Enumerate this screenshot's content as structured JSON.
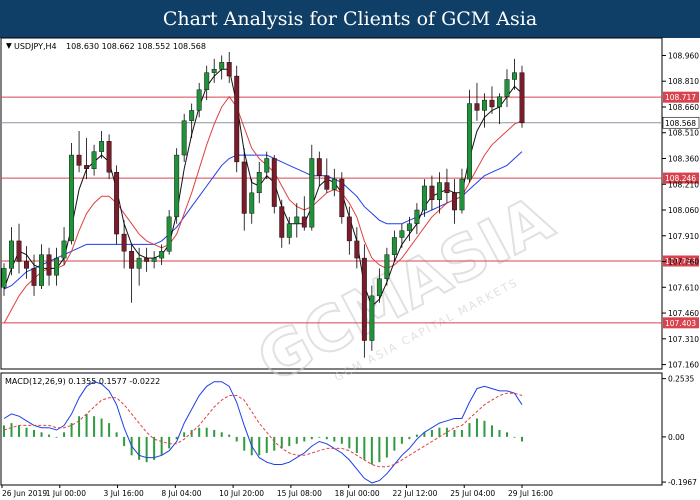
{
  "header": {
    "title": "Chart Analysis for Clients of GCM Asia"
  },
  "watermark": {
    "text": "GCMASIA",
    "subtext": "GCM ASIA CAPITAL MARKETS"
  },
  "chart_data": [
    {
      "type": "candlestick",
      "symbol_label": "USDJPY,H4",
      "ohlc_text": "108.630 108.662 108.552 108.568",
      "ylim": [
        107.14,
        109.05
      ],
      "y_ticks": [
        "108.960",
        "108.810",
        "108.660",
        "108.510",
        "108.360",
        "108.210",
        "108.060",
        "107.910",
        "107.760",
        "107.610",
        "107.460",
        "107.310",
        "107.160"
      ],
      "x_ticks": [
        "26 Jun 2019",
        "1 Jul 00:00",
        "3 Jul 16:00",
        "8 Jul 04:00",
        "10 Jul 20:00",
        "15 Jul 08:00",
        "18 Jul 00:00",
        "22 Jul 12:00",
        "25 Jul 04:00",
        "29 Jul 16:00"
      ],
      "levels": [
        {
          "label": "108.717",
          "value": 108.717,
          "color": "#d9434f"
        },
        {
          "label": "108.246",
          "value": 108.246,
          "color": "#d9434f"
        },
        {
          "label": "107.763",
          "value": 107.763,
          "color": "#d9434f"
        },
        {
          "label": "107.403",
          "value": 107.403,
          "color": "#d9434f"
        }
      ],
      "current_price": {
        "label": "108.568",
        "value": 108.568,
        "color": "#8a96a4"
      },
      "colors": {
        "bull": "#22913b",
        "bear": "#7a1c2a",
        "ma_fast": "#111111",
        "ma_mid": "#e04040",
        "ma_slow": "#1f3fe8"
      },
      "candles": [
        [
          107.61,
          107.75,
          107.56,
          107.72
        ],
        [
          107.72,
          107.96,
          107.68,
          107.88
        ],
        [
          107.88,
          107.98,
          107.69,
          107.76
        ],
        [
          107.76,
          107.85,
          107.66,
          107.72
        ],
        [
          107.72,
          107.8,
          107.56,
          107.62
        ],
        [
          107.62,
          107.86,
          107.6,
          107.8
        ],
        [
          107.8,
          107.84,
          107.62,
          107.68
        ],
        [
          107.68,
          107.84,
          107.62,
          107.78
        ],
        [
          107.78,
          107.96,
          107.74,
          107.88
        ],
        [
          107.88,
          108.45,
          107.86,
          108.38
        ],
        [
          108.38,
          108.52,
          108.28,
          108.32
        ],
        [
          108.32,
          108.48,
          108.24,
          108.3
        ],
        [
          108.3,
          108.44,
          108.26,
          108.4
        ],
        [
          108.4,
          108.52,
          108.36,
          108.46
        ],
        [
          108.46,
          108.5,
          108.24,
          108.28
        ],
        [
          108.28,
          108.32,
          107.86,
          107.92
        ],
        [
          107.92,
          108.0,
          107.72,
          107.82
        ],
        [
          107.82,
          107.86,
          107.52,
          107.72
        ],
        [
          107.72,
          107.84,
          107.62,
          107.78
        ],
        [
          107.78,
          107.84,
          107.7,
          107.76
        ],
        [
          107.76,
          107.82,
          107.72,
          107.78
        ],
        [
          107.78,
          107.86,
          107.74,
          107.82
        ],
        [
          107.82,
          108.06,
          107.8,
          108.02
        ],
        [
          108.02,
          108.42,
          107.98,
          108.38
        ],
        [
          108.38,
          108.62,
          108.34,
          108.58
        ],
        [
          108.58,
          108.68,
          108.48,
          108.64
        ],
        [
          108.64,
          108.8,
          108.6,
          108.76
        ],
        [
          108.76,
          108.9,
          108.7,
          108.86
        ],
        [
          108.86,
          108.94,
          108.8,
          108.88
        ],
        [
          108.88,
          108.96,
          108.82,
          108.92
        ],
        [
          108.92,
          108.98,
          108.8,
          108.84
        ],
        [
          108.84,
          108.9,
          108.28,
          108.34
        ],
        [
          108.34,
          108.42,
          107.94,
          108.04
        ],
        [
          108.04,
          108.24,
          107.98,
          108.16
        ],
        [
          108.16,
          108.34,
          108.1,
          108.28
        ],
        [
          108.28,
          108.4,
          108.24,
          108.36
        ],
        [
          108.36,
          108.38,
          108.04,
          108.08
        ],
        [
          108.08,
          108.12,
          107.84,
          107.9
        ],
        [
          107.9,
          108.02,
          107.86,
          107.98
        ],
        [
          107.98,
          108.1,
          107.9,
          108.02
        ],
        [
          108.02,
          108.14,
          107.94,
          107.96
        ],
        [
          107.96,
          108.44,
          107.94,
          108.36
        ],
        [
          108.36,
          108.4,
          108.2,
          108.26
        ],
        [
          108.26,
          108.36,
          108.16,
          108.18
        ],
        [
          108.18,
          108.3,
          108.14,
          108.24
        ],
        [
          108.24,
          108.28,
          107.98,
          108.02
        ],
        [
          108.02,
          108.08,
          107.8,
          107.88
        ],
        [
          107.88,
          107.96,
          107.72,
          107.78
        ],
        [
          107.78,
          107.86,
          107.2,
          107.3
        ],
        [
          107.3,
          107.62,
          107.24,
          107.56
        ],
        [
          107.56,
          107.72,
          107.52,
          107.66
        ],
        [
          107.66,
          107.84,
          107.62,
          107.8
        ],
        [
          107.8,
          107.94,
          107.76,
          107.9
        ],
        [
          107.9,
          107.98,
          107.84,
          107.94
        ],
        [
          107.94,
          108.02,
          107.88,
          107.98
        ],
        [
          107.98,
          108.1,
          107.92,
          108.06
        ],
        [
          108.06,
          108.24,
          108.02,
          108.2
        ],
        [
          108.2,
          108.26,
          108.06,
          108.12
        ],
        [
          108.12,
          108.28,
          108.04,
          108.22
        ],
        [
          108.22,
          108.3,
          108.1,
          108.16
        ],
        [
          108.16,
          108.24,
          107.98,
          108.06
        ],
        [
          108.06,
          108.3,
          108.04,
          108.24
        ],
        [
          108.24,
          108.76,
          108.22,
          108.68
        ],
        [
          108.68,
          108.8,
          108.58,
          108.64
        ],
        [
          108.64,
          108.74,
          108.54,
          108.7
        ],
        [
          108.7,
          108.78,
          108.62,
          108.66
        ],
        [
          108.66,
          108.74,
          108.56,
          108.72
        ],
        [
          108.72,
          108.88,
          108.66,
          108.82
        ],
        [
          108.82,
          108.94,
          108.76,
          108.86
        ],
        [
          108.86,
          108.9,
          108.54,
          108.568
        ]
      ],
      "ma_fast": [
        107.6,
        107.72,
        107.82,
        107.8,
        107.74,
        107.72,
        107.72,
        107.72,
        107.78,
        107.96,
        108.18,
        108.3,
        108.34,
        108.38,
        108.34,
        108.18,
        107.98,
        107.86,
        107.8,
        107.78,
        107.78,
        107.8,
        107.86,
        108.04,
        108.3,
        108.5,
        108.66,
        108.78,
        108.84,
        108.88,
        108.88,
        108.68,
        108.4,
        108.22,
        108.2,
        108.26,
        108.22,
        108.08,
        107.98,
        107.98,
        107.98,
        108.08,
        108.2,
        108.24,
        108.22,
        108.16,
        108.02,
        107.88,
        107.62,
        107.5,
        107.54,
        107.64,
        107.76,
        107.86,
        107.92,
        107.98,
        108.08,
        108.14,
        108.16,
        108.18,
        108.16,
        108.16,
        108.36,
        108.52,
        108.6,
        108.64,
        108.66,
        108.72,
        108.78,
        108.74
      ],
      "ma_mid": [
        107.4,
        107.48,
        107.56,
        107.62,
        107.66,
        107.7,
        107.72,
        107.72,
        107.74,
        107.82,
        107.94,
        108.04,
        108.1,
        108.14,
        108.14,
        108.1,
        108.04,
        107.98,
        107.92,
        107.88,
        107.86,
        107.84,
        107.86,
        107.92,
        108.04,
        108.16,
        108.3,
        108.44,
        108.56,
        108.66,
        108.72,
        108.66,
        108.54,
        108.42,
        108.36,
        108.32,
        108.28,
        108.2,
        108.12,
        108.08,
        108.06,
        108.08,
        108.12,
        108.16,
        108.18,
        108.16,
        108.1,
        108.02,
        107.88,
        107.78,
        107.74,
        107.72,
        107.74,
        107.78,
        107.84,
        107.9,
        107.96,
        108.02,
        108.06,
        108.1,
        108.12,
        108.14,
        108.22,
        108.3,
        108.38,
        108.44,
        108.48,
        108.52,
        108.56,
        108.58
      ],
      "ma_slow": [
        107.6,
        107.62,
        107.66,
        107.7,
        107.72,
        107.74,
        107.76,
        107.78,
        107.8,
        107.82,
        107.84,
        107.86,
        107.86,
        107.86,
        107.86,
        107.86,
        107.86,
        107.86,
        107.86,
        107.86,
        107.86,
        107.88,
        107.92,
        107.96,
        108.02,
        108.08,
        108.14,
        108.2,
        108.26,
        108.32,
        108.36,
        108.38,
        108.38,
        108.38,
        108.38,
        108.38,
        108.36,
        108.34,
        108.32,
        108.3,
        108.28,
        108.26,
        108.26,
        108.26,
        108.24,
        108.22,
        108.18,
        108.14,
        108.08,
        108.04,
        108.0,
        107.98,
        107.98,
        107.98,
        108.0,
        108.02,
        108.04,
        108.06,
        108.08,
        108.1,
        108.12,
        108.14,
        108.18,
        108.22,
        108.26,
        108.28,
        108.3,
        108.32,
        108.36,
        108.4
      ]
    },
    {
      "type": "macd",
      "label": "MACD(12,26,9) 0.1355 0.1577 -0.0222",
      "ylim": [
        -0.205,
        0.265
      ],
      "y_ticks": [
        {
          "label": "0.2535",
          "value": 0.2535
        },
        {
          "label": "0.00",
          "value": 0.0
        },
        {
          "label": "-0.1967",
          "value": -0.1967
        }
      ],
      "histogram": [
        0.05,
        0.06,
        0.05,
        0.04,
        0.03,
        0.02,
        0.01,
        0.0,
        0.02,
        0.06,
        0.09,
        0.1,
        0.09,
        0.08,
        0.06,
        0.02,
        -0.04,
        -0.08,
        -0.1,
        -0.11,
        -0.1,
        -0.08,
        -0.05,
        -0.01,
        0.02,
        0.03,
        0.04,
        0.04,
        0.03,
        0.02,
        0.01,
        -0.02,
        -0.06,
        -0.08,
        -0.08,
        -0.07,
        -0.06,
        -0.05,
        -0.04,
        -0.03,
        -0.02,
        -0.01,
        0.0,
        -0.01,
        -0.02,
        -0.03,
        -0.05,
        -0.07,
        -0.1,
        -0.12,
        -0.11,
        -0.09,
        -0.06,
        -0.03,
        -0.01,
        0.01,
        0.02,
        0.03,
        0.04,
        0.04,
        0.03,
        0.03,
        0.06,
        0.08,
        0.07,
        0.05,
        0.03,
        0.02,
        0.0,
        -0.02
      ],
      "macd": [
        0.08,
        0.1,
        0.09,
        0.07,
        0.05,
        0.04,
        0.04,
        0.03,
        0.05,
        0.1,
        0.17,
        0.22,
        0.24,
        0.23,
        0.2,
        0.14,
        0.04,
        -0.04,
        -0.08,
        -0.09,
        -0.09,
        -0.08,
        -0.06,
        -0.02,
        0.06,
        0.12,
        0.18,
        0.22,
        0.24,
        0.24,
        0.22,
        0.15,
        0.05,
        -0.04,
        -0.09,
        -0.11,
        -0.12,
        -0.12,
        -0.11,
        -0.09,
        -0.07,
        -0.04,
        -0.02,
        -0.03,
        -0.05,
        -0.07,
        -0.1,
        -0.14,
        -0.18,
        -0.2,
        -0.19,
        -0.16,
        -0.12,
        -0.08,
        -0.05,
        -0.01,
        0.02,
        0.04,
        0.06,
        0.07,
        0.08,
        0.08,
        0.15,
        0.21,
        0.22,
        0.21,
        0.2,
        0.2,
        0.19,
        0.14
      ],
      "signal": [
        0.03,
        0.04,
        0.05,
        0.05,
        0.05,
        0.05,
        0.05,
        0.04,
        0.04,
        0.05,
        0.07,
        0.1,
        0.13,
        0.16,
        0.17,
        0.17,
        0.14,
        0.1,
        0.06,
        0.02,
        -0.01,
        -0.02,
        -0.03,
        -0.03,
        -0.01,
        0.02,
        0.05,
        0.09,
        0.13,
        0.16,
        0.18,
        0.18,
        0.16,
        0.11,
        0.06,
        0.02,
        -0.02,
        -0.05,
        -0.07,
        -0.08,
        -0.08,
        -0.07,
        -0.06,
        -0.05,
        -0.05,
        -0.05,
        -0.06,
        -0.08,
        -0.1,
        -0.12,
        -0.13,
        -0.13,
        -0.12,
        -0.1,
        -0.08,
        -0.06,
        -0.04,
        -0.02,
        0.0,
        0.02,
        0.04,
        0.05,
        0.08,
        0.11,
        0.14,
        0.16,
        0.18,
        0.19,
        0.19,
        0.18
      ]
    }
  ]
}
